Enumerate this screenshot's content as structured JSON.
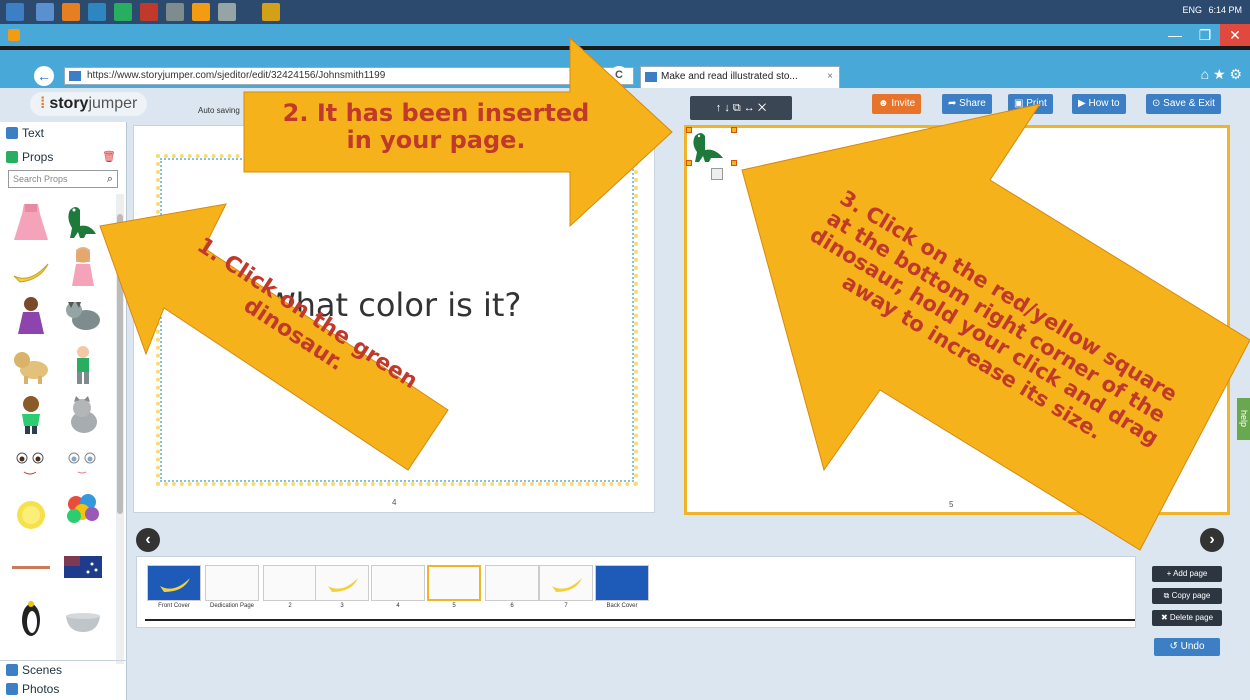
{
  "browser": {
    "url": "https://www.storyjumper.com/sjeditor/edit/32424156/Johnsmith1199",
    "tab_title": "Make and read illustrated sto...",
    "tab_close": "×",
    "window_min": "—",
    "window_max": "❐",
    "window_close": "✕",
    "back": "←",
    "forward": "→",
    "refresh": "C"
  },
  "taskbar": {
    "lang": "ENG",
    "time": "6:14 PM"
  },
  "app": {
    "logo_story": "story",
    "logo_jumper": "jumper",
    "autosave": "Auto saving",
    "buttons": {
      "invite": "Invite",
      "share": "Share",
      "print": "Print",
      "howto": "How to",
      "save_exit": "Save & Exit"
    }
  },
  "left_panel": {
    "text": "Text",
    "props": "Props",
    "search_placeholder": "Search Props",
    "scenes": "Scenes",
    "photos": "Photos"
  },
  "page_toolbar": {
    "label": "↑ ↓ ⧉ ↔ ✕"
  },
  "pages": {
    "left_text": "What color is it?",
    "left_num": "4",
    "right_num": "5"
  },
  "filmstrip": {
    "labels": [
      "Front Cover",
      "Dedication Page",
      "2",
      "3",
      "4",
      "5",
      "6",
      "7",
      "Back Cover"
    ],
    "add_page": "+ Add page",
    "copy_page": "⧉ Copy page",
    "delete_page": "✖ Delete page",
    "undo": "↺ Undo"
  },
  "help": "help",
  "callouts": {
    "one": "1. Click on the green dinosaur.",
    "two": "2. It has been inserted in your page.",
    "three": "3. Click on the red/yellow square at the bottom right corner of the dinosaur, hold your click and drag away to increase its size."
  },
  "colors": {
    "arrow_fill": "#f6b21a",
    "arrow_text": "#c0392b",
    "invite": "#e8732a",
    "blue_btn": "#3d7fc4",
    "selection": "#f0b429"
  }
}
